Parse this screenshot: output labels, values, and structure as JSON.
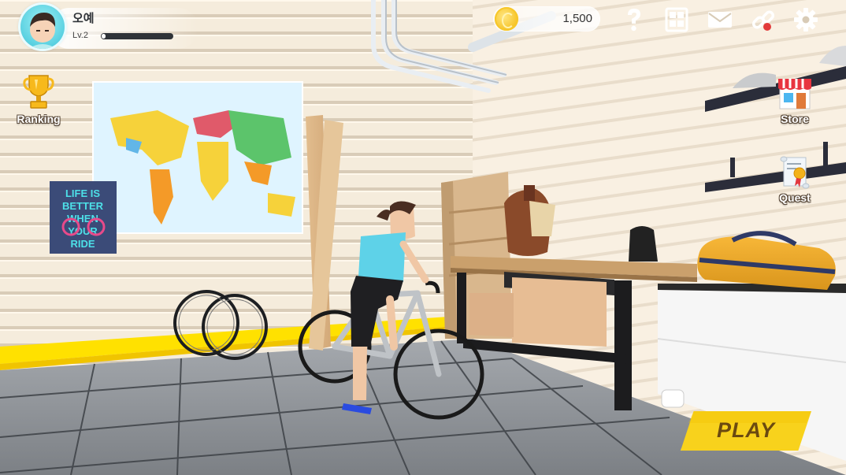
{
  "player": {
    "name": "오예",
    "level": "Lv.2",
    "xp_fraction": 0.05
  },
  "currency": {
    "coins": "1,500",
    "icon": "coin-icon"
  },
  "top_icons": [
    "help-icon",
    "ranking-board-icon",
    "mail-icon",
    "link-icon",
    "settings-icon"
  ],
  "side_buttons": {
    "ranking": "Ranking",
    "store": "Store",
    "quest": "Quest"
  },
  "poster": {
    "lines": [
      "LIFE IS",
      "BETTER",
      "WHEN",
      "YOUR",
      "RIDE"
    ]
  },
  "play_button": "PLAY",
  "colors": {
    "accent_yellow": "#f8d21c",
    "wall_cream": "#f4ead8",
    "floor_grey": "#8c9096"
  }
}
